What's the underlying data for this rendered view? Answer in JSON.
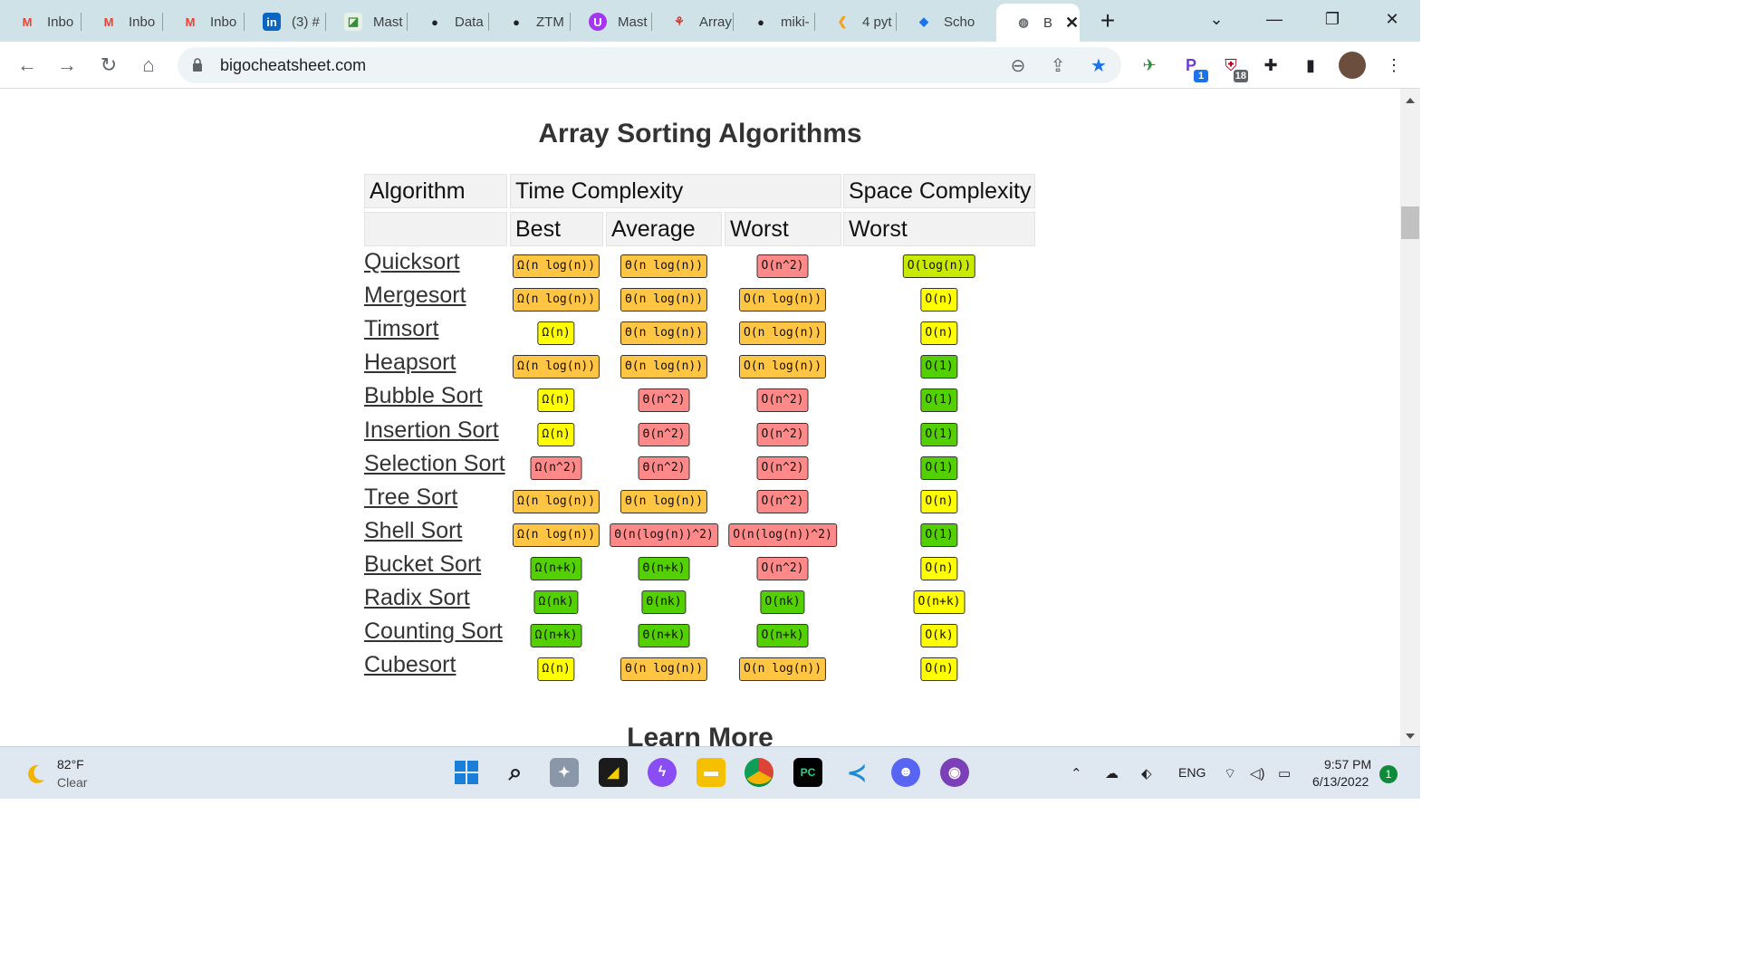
{
  "browser": {
    "tabs": [
      {
        "label": "Inbo",
        "icon": "gmail-icon"
      },
      {
        "label": "Inbo",
        "icon": "gmail-icon"
      },
      {
        "label": "Inbo",
        "icon": "gmail-icon"
      },
      {
        "label": "(3) #",
        "icon": "linkedin-icon"
      },
      {
        "label": "Mast",
        "icon": "notion-icon"
      },
      {
        "label": "Data",
        "icon": "github-icon"
      },
      {
        "label": "ZTM",
        "icon": "github-icon"
      },
      {
        "label": "Mast",
        "icon": "udemy-icon"
      },
      {
        "label": "Array",
        "icon": "figure-icon"
      },
      {
        "label": "miki-",
        "icon": "github-icon"
      },
      {
        "label": "4 pyt",
        "icon": "leetcode-icon"
      },
      {
        "label": "Scho",
        "icon": "school-icon"
      },
      {
        "label": "B",
        "icon": "globe-icon",
        "active": true
      }
    ],
    "url": "bigocheatsheet.com",
    "extensions": {
      "pocket_badge": "1",
      "ublock_badge": "18"
    }
  },
  "page": {
    "title": "Array Sorting Algorithms",
    "next_heading": "Learn More",
    "headers": {
      "algorithm": "Algorithm",
      "time": "Time Complexity",
      "space": "Space Complexity",
      "best": "Best",
      "average": "Average",
      "worst_time": "Worst",
      "worst_space": "Worst"
    },
    "rows": [
      {
        "name": "Quicksort",
        "best": "Ω(n log(n))",
        "best_c": "orange",
        "avg": "Θ(n log(n))",
        "avg_c": "orange",
        "worst": "O(n^2)",
        "worst_c": "red",
        "space": "O(log(n))",
        "space_c": "lime"
      },
      {
        "name": "Mergesort",
        "best": "Ω(n log(n))",
        "best_c": "orange",
        "avg": "Θ(n log(n))",
        "avg_c": "orange",
        "worst": "O(n log(n))",
        "worst_c": "orange",
        "space": "O(n)",
        "space_c": "yellow"
      },
      {
        "name": "Timsort",
        "best": "Ω(n)",
        "best_c": "yellow",
        "avg": "Θ(n log(n))",
        "avg_c": "orange",
        "worst": "O(n log(n))",
        "worst_c": "orange",
        "space": "O(n)",
        "space_c": "yellow"
      },
      {
        "name": "Heapsort",
        "best": "Ω(n log(n))",
        "best_c": "orange",
        "avg": "Θ(n log(n))",
        "avg_c": "orange",
        "worst": "O(n log(n))",
        "worst_c": "orange",
        "space": "O(1)",
        "space_c": "green"
      },
      {
        "name": "Bubble Sort",
        "best": "Ω(n)",
        "best_c": "yellow",
        "avg": "Θ(n^2)",
        "avg_c": "red",
        "worst": "O(n^2)",
        "worst_c": "red",
        "space": "O(1)",
        "space_c": "green"
      },
      {
        "name": "Insertion Sort",
        "best": "Ω(n)",
        "best_c": "yellow",
        "avg": "Θ(n^2)",
        "avg_c": "red",
        "worst": "O(n^2)",
        "worst_c": "red",
        "space": "O(1)",
        "space_c": "green"
      },
      {
        "name": "Selection Sort",
        "best": "Ω(n^2)",
        "best_c": "red",
        "avg": "Θ(n^2)",
        "avg_c": "red",
        "worst": "O(n^2)",
        "worst_c": "red",
        "space": "O(1)",
        "space_c": "green"
      },
      {
        "name": "Tree Sort",
        "best": "Ω(n log(n))",
        "best_c": "orange",
        "avg": "Θ(n log(n))",
        "avg_c": "orange",
        "worst": "O(n^2)",
        "worst_c": "red",
        "space": "O(n)",
        "space_c": "yellow"
      },
      {
        "name": "Shell Sort",
        "best": "Ω(n log(n))",
        "best_c": "orange",
        "avg": "Θ(n(log(n))^2)",
        "avg_c": "red",
        "worst": "O(n(log(n))^2)",
        "worst_c": "red",
        "space": "O(1)",
        "space_c": "green"
      },
      {
        "name": "Bucket Sort",
        "best": "Ω(n+k)",
        "best_c": "green",
        "avg": "Θ(n+k)",
        "avg_c": "green",
        "worst": "O(n^2)",
        "worst_c": "red",
        "space": "O(n)",
        "space_c": "yellow"
      },
      {
        "name": "Radix Sort",
        "best": "Ω(nk)",
        "best_c": "green",
        "avg": "Θ(nk)",
        "avg_c": "green",
        "worst": "O(nk)",
        "worst_c": "green",
        "space": "O(n+k)",
        "space_c": "yellow"
      },
      {
        "name": "Counting Sort",
        "best": "Ω(n+k)",
        "best_c": "green",
        "avg": "Θ(n+k)",
        "avg_c": "green",
        "worst": "O(n+k)",
        "worst_c": "green",
        "space": "O(k)",
        "space_c": "yellow"
      },
      {
        "name": "Cubesort",
        "best": "Ω(n)",
        "best_c": "yellow",
        "avg": "Θ(n log(n))",
        "avg_c": "orange",
        "worst": "O(n log(n))",
        "worst_c": "orange",
        "space": "O(n)",
        "space_c": "yellow"
      }
    ],
    "colors": {
      "orange": "#ffc543",
      "yellow": "#ffff00",
      "red": "#ff8989",
      "green": "#53d000",
      "lime": "#c8ea00"
    }
  },
  "taskbar": {
    "temperature": "82°F",
    "condition": "Clear",
    "language": "ENG",
    "time": "9:57 PM",
    "date": "6/13/2022",
    "notification_count": "1"
  }
}
